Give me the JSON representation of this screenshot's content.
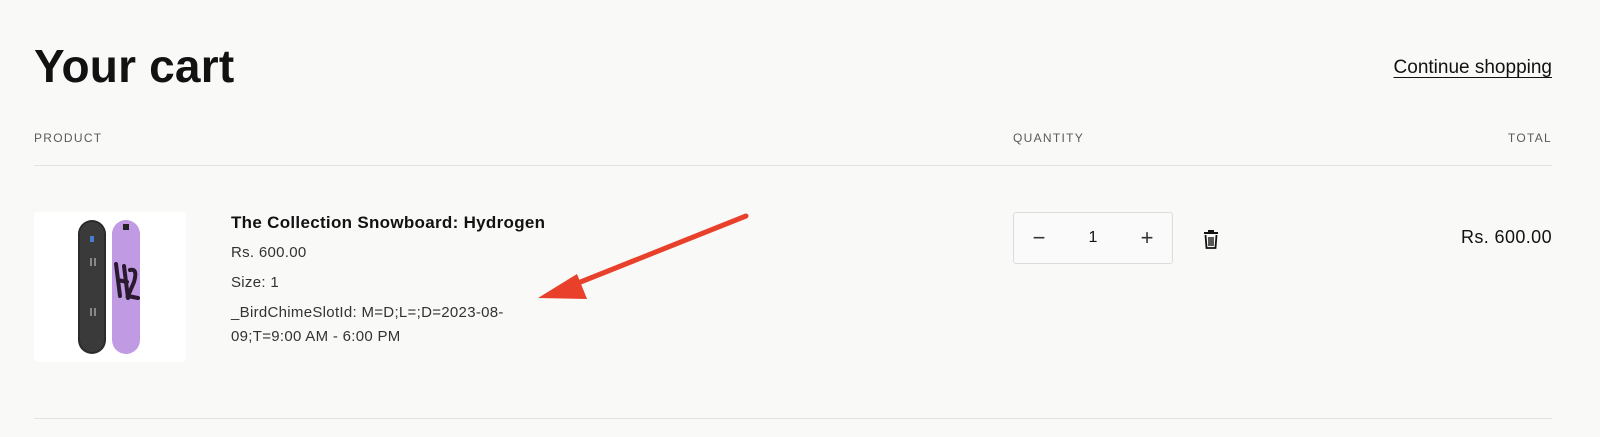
{
  "header": {
    "title": "Your cart",
    "continue_label": "Continue shopping"
  },
  "columns": {
    "product": "PRODUCT",
    "quantity": "QUANTITY",
    "total": "TOTAL"
  },
  "items": [
    {
      "name": "The Collection Snowboard: Hydrogen",
      "price": "Rs. 600.00",
      "size": "Size: 1",
      "property": "_BirdChimeSlotId: M=D;L=;D=2023-08-09;T=9:00 AM - 6:00 PM",
      "quantity": "1",
      "line_total": "Rs. 600.00",
      "minus_label": "−",
      "plus_label": "+"
    }
  ],
  "icons": {
    "remove": "trash-icon"
  },
  "colors": {
    "background": "#f9f9f7",
    "text": "#121212",
    "annotation_arrow": "#e8402b",
    "board_purple": "#c09ae3",
    "board_dark": "#2b2b2b"
  }
}
